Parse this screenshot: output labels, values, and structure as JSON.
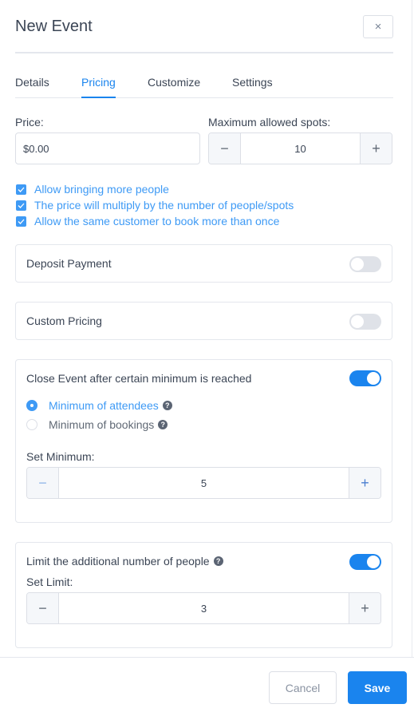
{
  "header": {
    "title": "New Event",
    "close_icon": "×"
  },
  "tabs": [
    {
      "label": "Details",
      "active": false
    },
    {
      "label": "Pricing",
      "active": true
    },
    {
      "label": "Customize",
      "active": false
    },
    {
      "label": "Settings",
      "active": false
    }
  ],
  "price": {
    "label": "Price:",
    "value": "$0.00"
  },
  "max_spots": {
    "label": "Maximum allowed spots:",
    "value": "10",
    "minus": "−",
    "plus": "+"
  },
  "checkboxes": [
    {
      "label": "Allow bringing more people",
      "checked": true
    },
    {
      "label": "The price will multiply by the number of people/spots",
      "checked": true
    },
    {
      "label": "Allow the same customer to book more than once",
      "checked": true
    }
  ],
  "deposit": {
    "label": "Deposit Payment",
    "enabled": false
  },
  "custom_pricing": {
    "label": "Custom Pricing",
    "enabled": false
  },
  "close_event": {
    "label": "Close Event after certain minimum is reached",
    "enabled": true,
    "options": [
      {
        "label": "Minimum of attendees",
        "selected": true
      },
      {
        "label": "Minimum of bookings",
        "selected": false
      }
    ],
    "set_label": "Set Minimum:",
    "value": "5",
    "minus": "−",
    "plus": "+"
  },
  "limit_people": {
    "label": "Limit the additional number of people",
    "enabled": true,
    "set_label": "Set Limit:",
    "value": "3",
    "minus": "−",
    "plus": "+"
  },
  "help_icon": "?",
  "footer": {
    "cancel_label": "Cancel",
    "save_label": "Save"
  },
  "colors": {
    "accent": "#1a84ee",
    "checkbox": "#3e9af5",
    "text": "#3b4555"
  }
}
